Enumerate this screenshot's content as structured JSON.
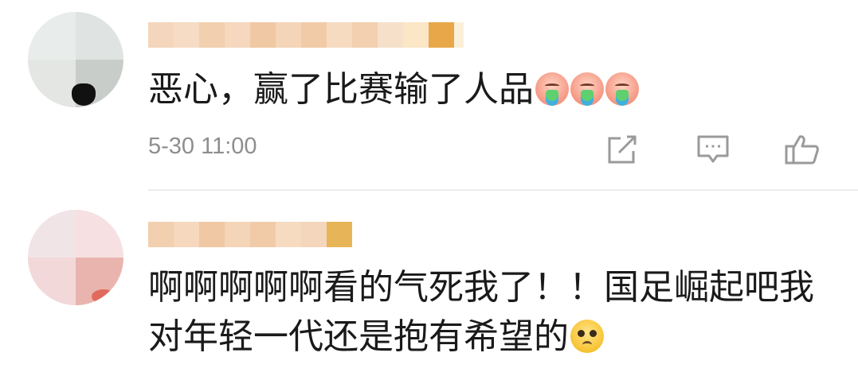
{
  "comments": [
    {
      "text": "恶心，赢了比赛输了人品",
      "emojis": [
        "vomit-emoji",
        "vomit-emoji",
        "vomit-emoji"
      ],
      "timestamp": "5-30 11:00",
      "actions": [
        "share-icon",
        "comment-icon",
        "like-icon"
      ]
    },
    {
      "text_line1": "啊啊啊啊啊看的气死我了！！国足崛起吧我",
      "text_line2": "对年轻一代还是抱有希望的",
      "emojis": [
        "pleading-emoji"
      ]
    }
  ],
  "colors": {
    "text": "#1a1a1a",
    "timestamp": "#8e8e8e",
    "icon": "#9a9a9a",
    "divider": "#ececec",
    "username_blur": "#f0c9a3",
    "username_accent": "#e8a84a"
  }
}
